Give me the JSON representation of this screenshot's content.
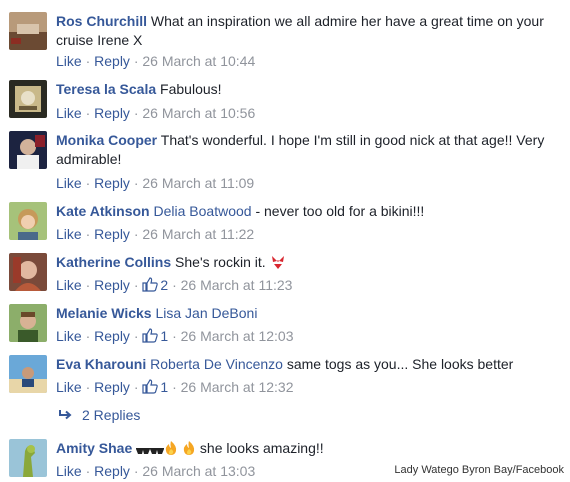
{
  "actions": {
    "like": "Like",
    "reply": "Reply",
    "dot": "·"
  },
  "comments": [
    {
      "author": "Ros Churchill",
      "text": "What an inspiration we all admire her have a great time on your cruise Irene X",
      "time": "26 March at 10:44"
    },
    {
      "author": "Teresa la Scala",
      "text": "Fabulous!",
      "time": "26 March at 10:56"
    },
    {
      "author": "Monika Cooper",
      "text": "That's wonderful. I hope I'm still in good nick at that age!! Very admirable!",
      "time": "26 March at 11:09"
    },
    {
      "author": "Kate Atkinson",
      "mention": "Delia Boatwood",
      "text": " - never too old for a bikini!!!",
      "time": "26 March at 11:22"
    },
    {
      "author": "Katherine Collins",
      "text": "She's rockin it.",
      "emoji": "bikini-emoji",
      "likes": "2",
      "time": "26 March at 11:23"
    },
    {
      "author": "Melanie Wicks",
      "mention": "Lisa Jan DeBoni",
      "likes": "1",
      "time": "26 March at 12:03"
    },
    {
      "author": "Eva Kharouni",
      "mention": "Roberta De Vincenzo",
      "text": " same togs as you... She looks better",
      "likes": "1",
      "time": "26 March at 12:32"
    },
    {
      "author": "Amity Shae",
      "emoji": "sunglasses-fire-emoji",
      "text": "she looks amazing!!",
      "time": "26 March at 13:03"
    }
  ],
  "replies_link": "2 Replies",
  "caption": "Lady Watego Byron Bay/Facebook",
  "colors": {
    "link": "#365899",
    "meta": "#90949c",
    "text": "#1d2129"
  }
}
